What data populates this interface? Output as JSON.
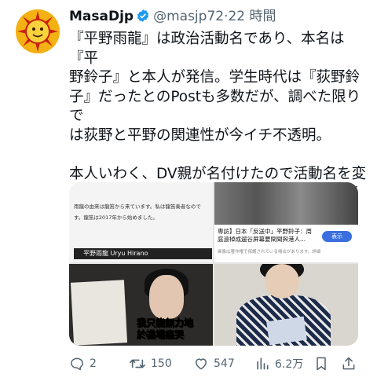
{
  "author": {
    "display_name": "MasaDjp",
    "handle": "@masjp72",
    "separator": "·",
    "time_ago": "22 時間",
    "verified_color": "#1d9bf0"
  },
  "tweet": {
    "paragraph1": "『平野雨龍』は政治活動名であり、本名は『平\n野鈴子』と本人が発信。学生時代は『荻野鈴\n子』だったとのPostも多数だが、調べた限りで\nは荻野と平野の関連性が今イチ不透明。",
    "paragraph2": "本人いわく、DV親が名付けたので活動名を変\nえたらしいが、香港で散々、本名で中国ヘイト\n活動を行っていたのに解せない。続"
  },
  "media": {
    "image1_text": "雨龍の由来は龍笛から来ています。私は龍笛奏者なので す。龍笛は2017年から始めました。",
    "image1_bar": "平野雨龍 Uryu Hirano",
    "image2_headline": "専訪】日本「反送中」平野鈴子：周庭遠棹成遛谷屏幕要閘聞與港人...",
    "image2_subtext": "画像は著作権で保護されている場合があります。詳細",
    "image2_button": "表示",
    "image3_caption_line1": "我只能無力地",
    "image3_caption_line2": "於機場痛哭"
  },
  "actions": {
    "reply_count": "2",
    "retweet_count": "150",
    "like_count": "547",
    "view_count": "6.2万"
  },
  "colors": {
    "text": "#0f1419",
    "muted": "#536471",
    "accent": "#1d9bf0"
  }
}
